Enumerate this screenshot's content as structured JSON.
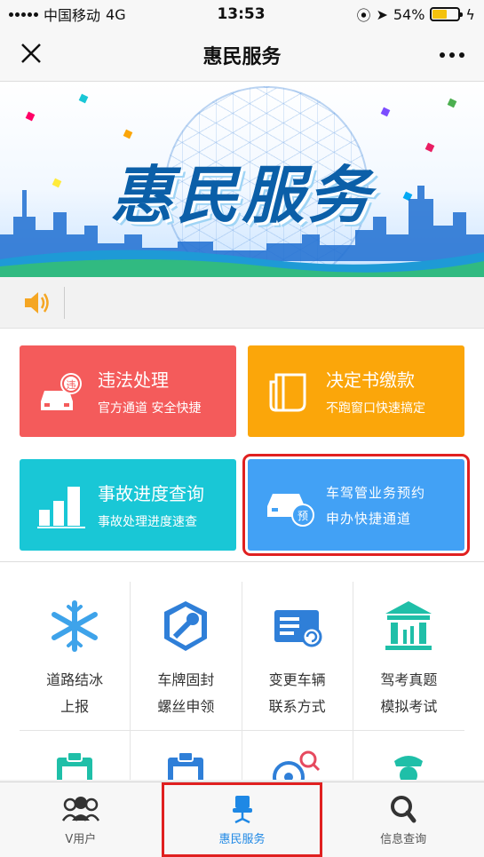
{
  "status_bar": {
    "carrier": "中国移动",
    "network": "4G",
    "time": "13:53",
    "battery_percent": "54%",
    "battery_level": 0.54
  },
  "nav": {
    "title": "惠民服务",
    "close_icon": "close-icon",
    "more_icon": "more-icon"
  },
  "banner": {
    "title": "惠民服务"
  },
  "notice": {
    "icon": "speaker-icon"
  },
  "cards": [
    {
      "title": "违法处理",
      "subtitle": "官方通道 安全快捷",
      "color": "#f45b5b",
      "icon": "violation-car-icon"
    },
    {
      "title": "决定书缴款",
      "subtitle": "不跑窗口快速搞定",
      "color": "#fba60a",
      "icon": "document-icon"
    },
    {
      "title": "事故进度查询",
      "subtitle": "事故处理进度速查",
      "color": "#19c7d6",
      "icon": "progress-bars-icon"
    },
    {
      "title": "车驾管业务预约",
      "subtitle": "申办快捷通道",
      "color": "#42a1f5",
      "icon": "appointment-car-icon"
    }
  ],
  "grid": [
    {
      "label": "道路结冰\n上报",
      "icon": "snowflake-icon"
    },
    {
      "label": "车牌固封\n螺丝申领",
      "icon": "bolt-shield-icon"
    },
    {
      "label": "变更车辆\n联系方式",
      "icon": "id-card-icon"
    },
    {
      "label": "驾考真题\n模拟考试",
      "icon": "exam-building-icon"
    },
    {
      "label": "",
      "icon": "clipboard-icon"
    },
    {
      "label": "",
      "icon": "clipboard-icon"
    },
    {
      "label": "",
      "icon": "search-location-icon"
    },
    {
      "label": "",
      "icon": "police-officer-icon"
    }
  ],
  "tabs": [
    {
      "label": "V用户",
      "icon": "users-icon",
      "active": false
    },
    {
      "label": "惠民服务",
      "icon": "office-chair-icon",
      "active": true
    },
    {
      "label": "信息查询",
      "icon": "search-icon",
      "active": false
    }
  ],
  "colors": {
    "accent": "#1e88e5",
    "highlight_border": "#e02020"
  }
}
